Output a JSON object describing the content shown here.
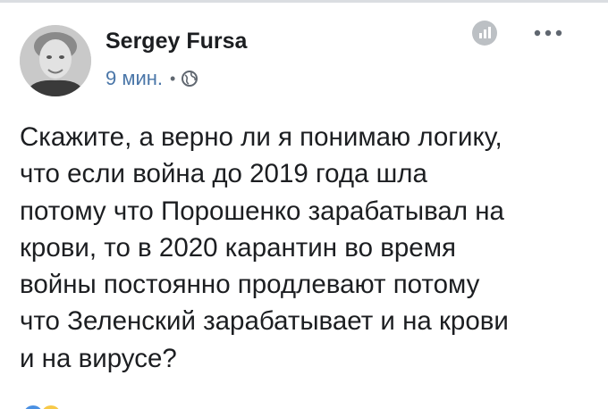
{
  "author": {
    "name": "Sergey Fursa",
    "avatar_icon": "profile-photo"
  },
  "meta": {
    "time": "9 мин.",
    "separator": "•",
    "audience_icon": "globe-icon"
  },
  "header_icons": {
    "stats": "bar-chart-icon",
    "more": "more-options-icon"
  },
  "post": {
    "lines": [
      "Скажите, а верно ли я понимаю логику,",
      "что если война до 2019 года шла",
      "потому что Порошенко зарабатывал на",
      "крови, то в 2020 карантин во время",
      "войны постоянно продлевают потому",
      "что Зеленский зарабатывает и на крови",
      "и на вирусе?"
    ]
  },
  "reactions": {
    "icons": [
      "like-reaction-icon",
      "haha-reaction-icon"
    ]
  },
  "colors": {
    "text": "#1c1e21",
    "meta": "#606770",
    "link": "#4a76a8",
    "divider": "#dadde1"
  }
}
